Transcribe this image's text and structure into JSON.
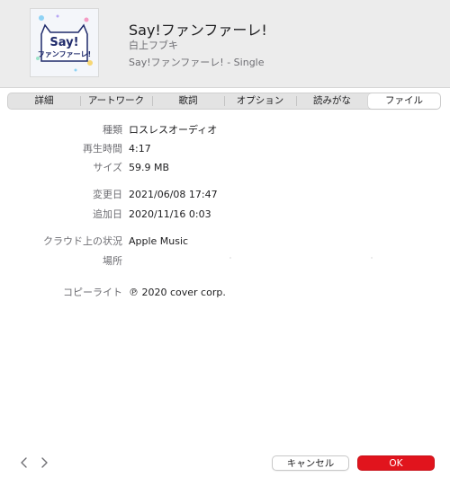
{
  "header": {
    "title": "Say!ファンファーレ!",
    "artist": "白上フブキ",
    "album": "Say!ファンファーレ! - Single",
    "artwork": {
      "line1": "Say!",
      "line2": "ファンファーレ!",
      "accent_color": "#1f2a6b"
    }
  },
  "tabs": [
    {
      "label": "詳細",
      "active": false
    },
    {
      "label": "アートワーク",
      "active": false
    },
    {
      "label": "歌詞",
      "active": false
    },
    {
      "label": "オプション",
      "active": false
    },
    {
      "label": "読みがな",
      "active": false
    },
    {
      "label": "ファイル",
      "active": true
    }
  ],
  "file_info": {
    "kind": {
      "label": "種類",
      "value": "ロスレスオーディオ"
    },
    "duration": {
      "label": "再生時間",
      "value": "4:17"
    },
    "size": {
      "label": "サイズ",
      "value": "59.9 MB"
    },
    "modified": {
      "label": "変更日",
      "value": "2021/06/08 17:47"
    },
    "added": {
      "label": "追加日",
      "value": "2020/11/16 0:03"
    },
    "cloud_status": {
      "label": "クラウド上の状況",
      "value": "Apple Music"
    },
    "location": {
      "label": "場所",
      "value": ""
    },
    "copyright": {
      "label": "コピーライト",
      "value": "℗ 2020 cover corp."
    }
  },
  "footer": {
    "prev_icon": "chevron-left-icon",
    "next_icon": "chevron-right-icon",
    "cancel_label": "キャンセル",
    "ok_label": "OK"
  },
  "colors": {
    "ok_button": "#e1141d",
    "header_bg": "#ececec"
  }
}
